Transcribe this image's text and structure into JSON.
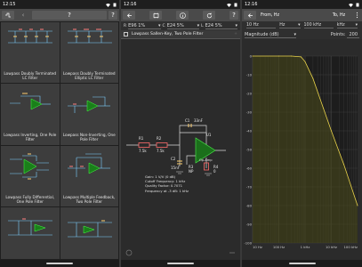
{
  "status": [
    {
      "time": "12:15"
    },
    {
      "time": "12:16"
    },
    {
      "time": "12:16"
    }
  ],
  "panel1": {
    "toolbar": {
      "back": "‹",
      "help": "?"
    },
    "filters": [
      {
        "label": "Lowpass Doubly Terminated LC Filter"
      },
      {
        "label": "Lowpass Doubly Terminated Elliptic LC Filter"
      },
      {
        "label": "Lowpass Inverting, One Pole Filter"
      },
      {
        "label": "Lowpass Non-Inverting, One Pole Filter"
      },
      {
        "label": "Lowpass Fully Differential, One Pole Filter"
      },
      {
        "label": "Lowpass Multiple Feedback, Two Pole Filter"
      },
      {
        "label": ""
      },
      {
        "label": ""
      }
    ]
  },
  "panel2": {
    "toolbar": {
      "help": "?"
    },
    "series": [
      {
        "value": "E96 1%"
      },
      {
        "value": "E24 5%"
      },
      {
        "value": "E24 5%"
      }
    ],
    "title": "Lowpass Sallen-Key, Two Pole Filter",
    "components": {
      "r1": "R1",
      "r1v": "7.5k",
      "r2": "R2",
      "r2v": "7.5k",
      "c1": "C1",
      "c1v": "33nF",
      "c2": "C2",
      "c2v": "15nF",
      "r3": "R3",
      "r3v": "NP",
      "r4": "R4",
      "r4v": "0",
      "u1": "U1",
      "amp": "Op-Amp"
    },
    "info": [
      "Gain: 1 V/V (0 dB)",
      "Cutoff Frequency: 1 kHz",
      "Quality Factor: 0.7071",
      "Frequency at -3 dB: 1 kHz"
    ]
  },
  "panel3": {
    "from_label": "From, Hz",
    "to_label": "To, Hz",
    "from_value": "10 Hz",
    "from_unit": "Hz",
    "to_value": "100 kHz",
    "to_unit": "kHz",
    "plot_type": "Magnitude (dB)",
    "points_label": "Points:",
    "points_value": "200",
    "y_ticks": [
      "0",
      "-10",
      "-20",
      "-30",
      "-40",
      "-50",
      "-60",
      "-70",
      "-80",
      "-90",
      "-100"
    ],
    "x_ticks": [
      "10 Hz",
      "100 Hz",
      "1 kHz",
      "10 kHz",
      "100 kHz"
    ]
  },
  "chart_data": {
    "type": "line",
    "title": "Magnitude (dB)",
    "xlabel": "",
    "ylabel": "",
    "x_scale": "log",
    "xlim": [
      10,
      100000
    ],
    "ylim": [
      -100,
      0
    ],
    "grid": true,
    "series": [
      {
        "x": [
          10,
          100,
          300,
          700,
          1000,
          2000,
          5000,
          10000,
          30000,
          100000
        ],
        "y": [
          0,
          0,
          0,
          -0.4,
          -3,
          -12,
          -28,
          -40,
          -58,
          -80
        ]
      }
    ]
  }
}
